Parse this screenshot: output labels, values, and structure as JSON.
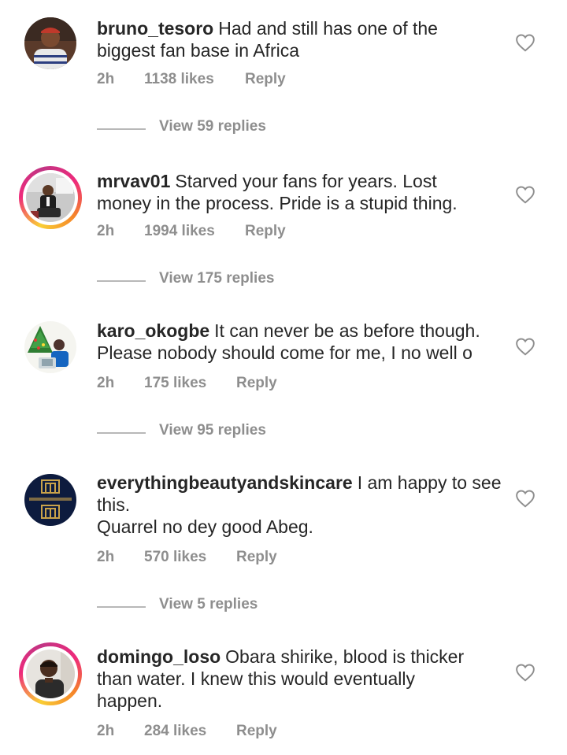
{
  "comments": [
    {
      "username": "bruno_tesoro",
      "text": "Had and still has one of the\nbiggest fan base in Africa",
      "time": "2h",
      "likes": "1138 likes",
      "reply_label": "Reply",
      "view_replies": "View 59 replies",
      "avatar_ring": false
    },
    {
      "username": "mrvav01",
      "text": "Starved your fans for years. Lost\nmoney in the process. Pride is a stupid thing.",
      "time": "2h",
      "likes": "1994 likes",
      "reply_label": "Reply",
      "view_replies": "View 175 replies",
      "avatar_ring": true
    },
    {
      "username": "karo_okogbe",
      "text": "It can never be as before though.\nPlease nobody should come for me, I no well o",
      "time": "2h",
      "likes": "175 likes",
      "reply_label": "Reply",
      "view_replies": "View 95 replies",
      "avatar_ring": false
    },
    {
      "username": "everythingbeautyandskincare",
      "text": "I am happy to see\nthis.\nQuarrel no dey good Abeg.",
      "time": "2h",
      "likes": "570 likes",
      "reply_label": "Reply",
      "view_replies": "View 5 replies",
      "avatar_ring": false
    },
    {
      "username": "domingo_loso",
      "text": "Obara shirike, blood is thicker\nthan water. I knew this would eventually\nhappen.",
      "time": "2h",
      "likes": "284 likes",
      "reply_label": "Reply",
      "view_replies": "",
      "avatar_ring": true
    }
  ],
  "colors": {
    "text": "#262626",
    "meta": "#8e8e8e",
    "divider": "#b8b8b8"
  },
  "icons": {
    "like": "heart-outline-icon"
  }
}
